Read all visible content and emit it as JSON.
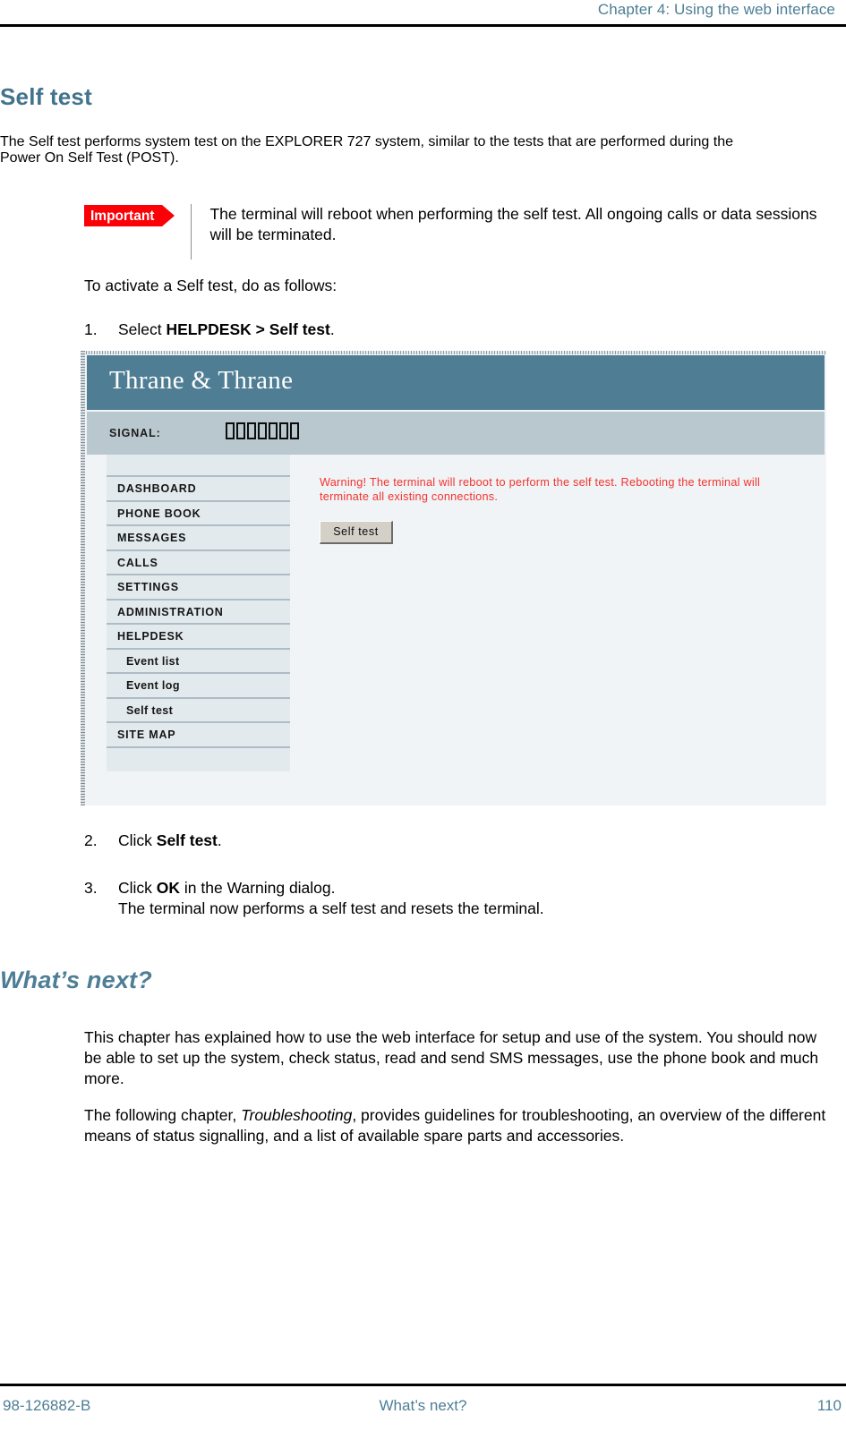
{
  "header": {
    "chapter": "Chapter 4: Using the web interface"
  },
  "section": {
    "title": "Self test",
    "intro": "The Self test performs system test on the EXPLORER 727 system, similar to the tests that are performed during the Power On Self Test (POST).",
    "note_badge": "Important",
    "note_text": "The terminal will reboot when performing the self test. All ongoing calls or data sessions will be terminated.",
    "lead_in": "To activate a Self test, do as follows:"
  },
  "steps": [
    {
      "number": "1.",
      "prefix": "Select ",
      "bold": "HELPDESK > Self test",
      "suffix": ".",
      "detail": ""
    },
    {
      "number": "2.",
      "prefix": "Click ",
      "bold": "Self test",
      "suffix": ".",
      "detail": ""
    },
    {
      "number": "3.",
      "prefix": "Click ",
      "bold": "OK",
      "suffix": " in the Warning dialog.",
      "detail": "The terminal now performs a self test and resets the terminal."
    }
  ],
  "screenshot": {
    "brand": "Thrane & Thrane",
    "signal_label": "SIGNAL:",
    "signal_bars": 7,
    "nav_items": [
      {
        "label": "DASHBOARD",
        "sub": false
      },
      {
        "label": "PHONE BOOK",
        "sub": false
      },
      {
        "label": "MESSAGES",
        "sub": false
      },
      {
        "label": "CALLS",
        "sub": false
      },
      {
        "label": "SETTINGS",
        "sub": false
      },
      {
        "label": "ADMINISTRATION",
        "sub": false
      },
      {
        "label": "HELPDESK",
        "sub": false
      },
      {
        "label": "Event list",
        "sub": true
      },
      {
        "label": "Event log",
        "sub": true
      },
      {
        "label": "Self test",
        "sub": true
      },
      {
        "label": "SITE MAP",
        "sub": false
      }
    ],
    "warning": "Warning! The terminal will reboot to perform the self test. Rebooting the terminal will terminate all existing connections.",
    "button_label": "Self test",
    "colors": {
      "brand_bar": "#4f7e94",
      "signal_bar": "#b9c8ce",
      "page_bg": "#f0f4f7",
      "nav_row": "#e3eaee",
      "warning_text": "#f5322c"
    }
  },
  "whats_next": {
    "title": "What’s next?",
    "para1": "This chapter has explained how to use the web interface for setup and use of the system. You should now be able to set up the system, check status, read and send SMS messages, use the phone book and much more.",
    "para2_a": "The following chapter, ",
    "para2_italic": "Troubleshooting",
    "para2_b": ", provides guidelines for troubleshooting, an overview of the different means of status signalling, and a list of available spare parts and accessories."
  },
  "footer": {
    "doc_number": "98-126882-B",
    "center": "What’s next?",
    "page_number": "110"
  }
}
